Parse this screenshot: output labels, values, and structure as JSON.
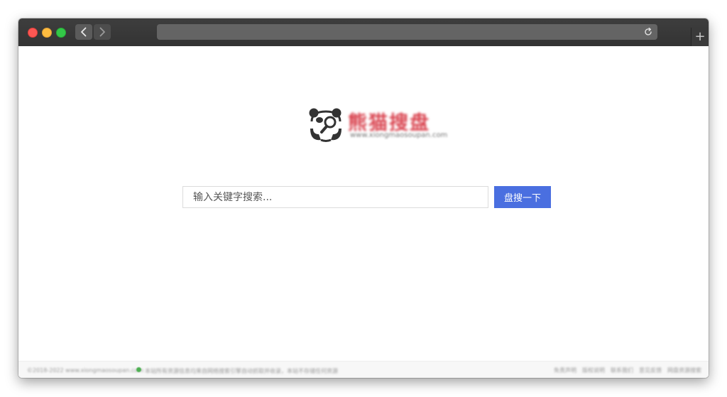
{
  "toolbar": {
    "back_icon": "chevron-left-icon",
    "forward_icon": "chevron-right-icon",
    "reload_icon": "reload-icon",
    "new_tab_label": "+"
  },
  "address_bar": {
    "value": ""
  },
  "logo": {
    "icon": "panda-magnifier-icon",
    "title": "熊猫搜盘",
    "url": "www.xiongmaosoupan.com"
  },
  "search": {
    "placeholder": "输入关键字搜索...",
    "value": "",
    "button_label": "盘搜一下"
  },
  "colors": {
    "accent": "#4a6fe0",
    "brand_red": "#d9434f",
    "titlebar": "#333333"
  },
  "footer": {
    "copyright": "©2018-2022 www.xiongmaosoupan.com",
    "notice": "本站所有资源信息均来自网络搜索引擎自动抓取并收录，本站不存储任何资源",
    "links": [
      "免责声明",
      "版权说明",
      "联系我们",
      "意见反馈",
      "网盘资源搜索"
    ]
  }
}
